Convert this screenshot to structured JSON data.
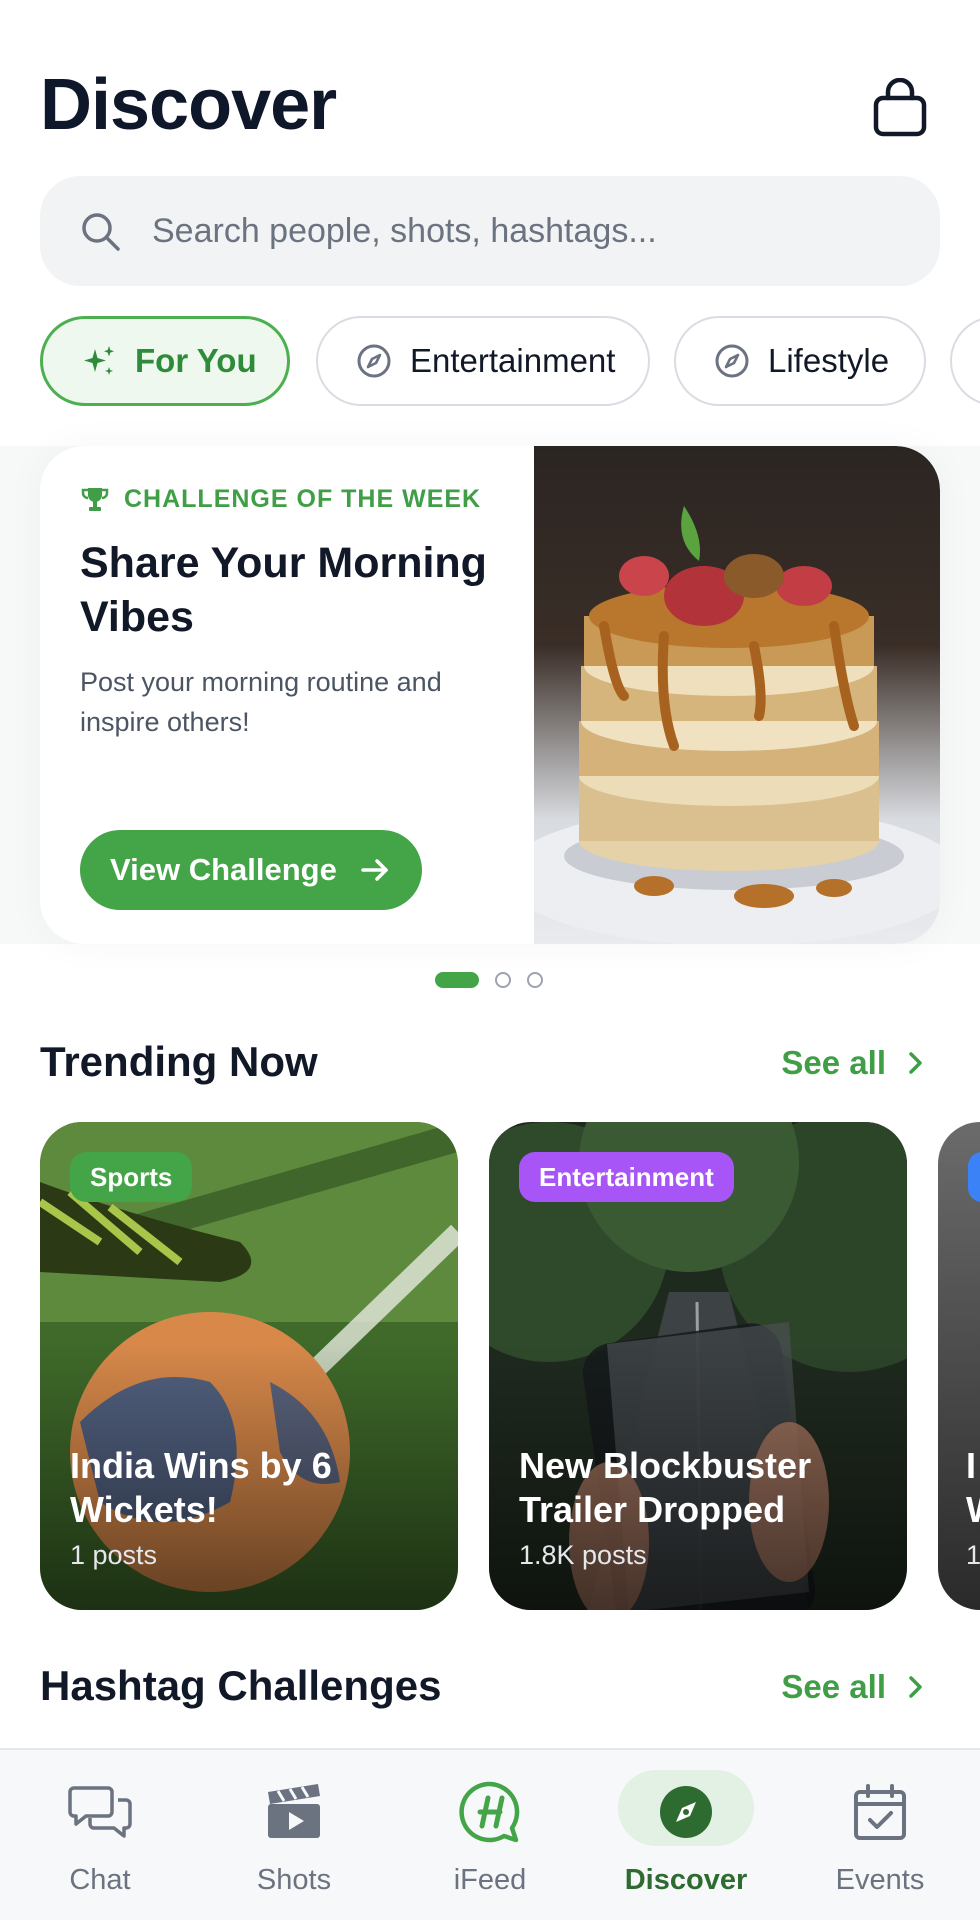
{
  "header": {
    "title": "Discover",
    "search_placeholder": "Search people, shots, hashtags..."
  },
  "chips": [
    {
      "label": "For You",
      "icon": "sparkles-icon",
      "active": true
    },
    {
      "label": "Entertainment",
      "icon": "compass-icon",
      "active": false
    },
    {
      "label": "Lifestyle",
      "icon": "compass-icon",
      "active": false
    }
  ],
  "hero": {
    "eyebrow": "CHALLENGE OF THE WEEK",
    "title": "Share Your Morning Vibes",
    "description": "Post your morning routine and inspire others!",
    "cta": "View Challenge",
    "image": "pancakes-photo",
    "pages": 3,
    "current_page": 1
  },
  "trending": {
    "title": "Trending Now",
    "see_all": "See all",
    "cards": [
      {
        "badge": "Sports",
        "badge_color": "#43a547",
        "title": "India Wins by 6 Wickets!",
        "count": "1 posts",
        "image": "football-photo"
      },
      {
        "badge": "Entertainment",
        "badge_color": "#a855f7",
        "title": "New Blockbuster Trailer Dropped",
        "count": "1.8K posts",
        "image": "forest-road-phone-photo"
      },
      {
        "badge": "",
        "badge_color": "#3b82f6",
        "title": "I W",
        "count": "1",
        "image": "sheet-music-photo"
      }
    ]
  },
  "hashtags": {
    "title": "Hashtag Challenges",
    "see_all": "See all"
  },
  "tabbar": [
    {
      "label": "Chat",
      "icon": "chat-bubbles-icon",
      "active": false
    },
    {
      "label": "Shots",
      "icon": "clapperboard-icon",
      "active": false
    },
    {
      "label": "iFeed",
      "icon": "ifeed-logo-icon",
      "active": false
    },
    {
      "label": "Discover",
      "icon": "compass-icon",
      "active": true
    },
    {
      "label": "Events",
      "icon": "calendar-check-icon",
      "active": false
    }
  ],
  "colors": {
    "accent": "#43a547",
    "accent_dark": "#2e6b31",
    "text": "#111827",
    "muted": "#6b7280"
  }
}
